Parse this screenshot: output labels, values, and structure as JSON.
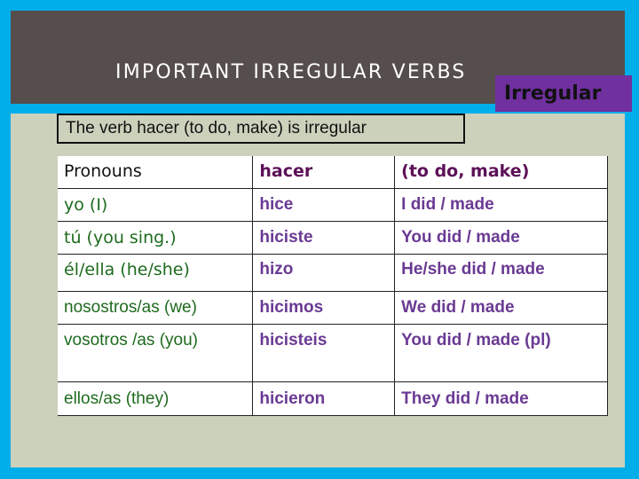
{
  "slide": {
    "title": "IMPORTANT IRREGULAR VERBS",
    "badge": "Irregular",
    "subtitle": "The verb hacer (to do, make) is irregular"
  },
  "colors": {
    "frame": "#00aeea",
    "header_bg": "#554e4c",
    "body_bg": "#ccd1bc",
    "badge_bg": "#7030a0",
    "pronoun_text": "#1e6b1e",
    "verb_text": "#6a3a93"
  },
  "table": {
    "header": {
      "pronoun": "Pronouns",
      "verb": "hacer",
      "translation": "(to do, make)"
    },
    "rows": [
      {
        "pronoun": "yo (I)",
        "verb": "hice",
        "translation": "I did / made"
      },
      {
        "pronoun": "tú (you sing.)",
        "verb": "hiciste",
        "translation": "You did / made"
      },
      {
        "pronoun": "él/ella (he/she)",
        "verb": "hizo",
        "translation": "He/she did  / made"
      },
      {
        "pronoun": "nosostros/as (we)",
        "verb": "hicimos",
        "translation": "We did / made"
      },
      {
        "pronoun": "vosotros /as (you)",
        "verb": "hicisteis",
        "translation": "You did / made (pl)"
      },
      {
        "pronoun": "ellos/as (they)",
        "verb": "hicieron",
        "translation": "They did / made"
      }
    ]
  }
}
